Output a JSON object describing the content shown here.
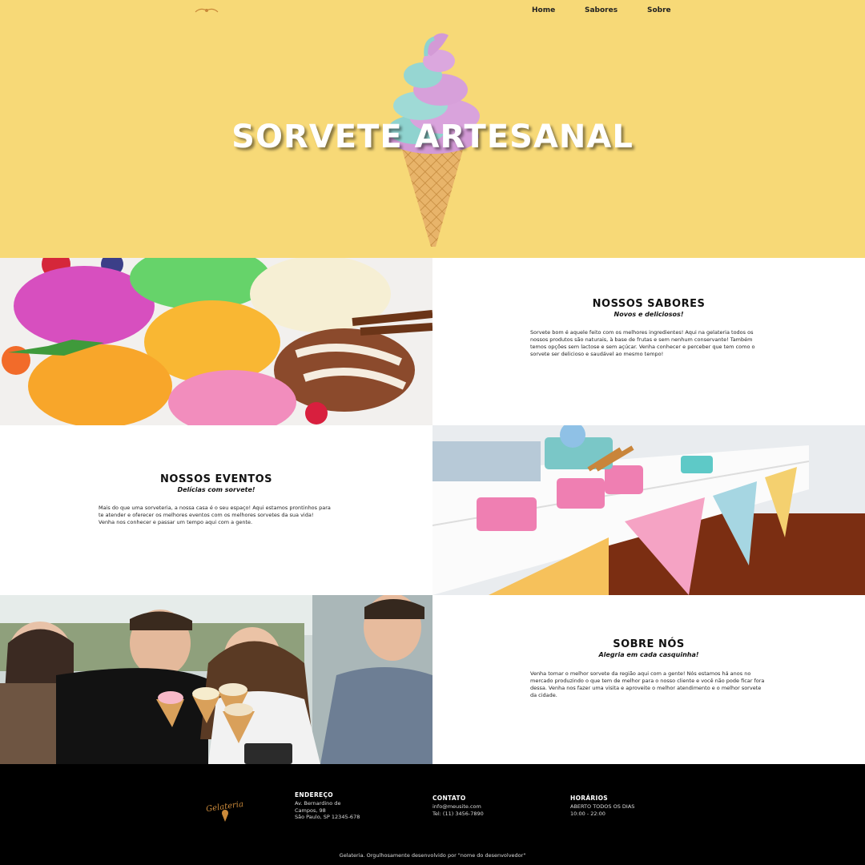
{
  "nav": {
    "items": [
      {
        "label": "Home"
      },
      {
        "label": "Sabores"
      },
      {
        "label": "Sobre"
      }
    ]
  },
  "hero": {
    "title": "SORVETE ARTESANAL"
  },
  "sections": [
    {
      "title": "NOSSOS SABORES",
      "subtitle": "Novos e deliciosos!",
      "body": "Sorvete bom é aquele feito com os melhores ingredientes! Aqui na gelateria todos os nossos produtos são naturais, à base de frutas e sem nenhum conservante! Também temos opções sem lactose e sem açúcar. Venha conhecer e perceber que tem como o sorvete ser delicioso e saudável ao mesmo tempo!"
    },
    {
      "title": "NOSSOS EVENTOS",
      "subtitle": "Delícias com sorvete!",
      "body": "Mais do que uma sorveteria, a nossa casa é o seu espaço! Aqui estamos prontinhos para te atender e oferecer os melhores eventos com os melhores sorvetes da sua vida! Venha nos conhecer e passar um tempo aqui com a gente."
    },
    {
      "title": "SOBRE NÓS",
      "subtitle": "Alegria em cada casquinha!",
      "body": "Venha tomar o melhor sorvete da região aqui com a gente! Nós estamos há anos no mercado produzindo o que tem de melhor para o nosso cliente e você não pode ficar fora dessa. Venha nos fazer uma visita e aproveite o melhor atendimento e o melhor sorvete da cidade."
    }
  ],
  "footer": {
    "logo_text": "Gelateria",
    "columns": [
      {
        "heading": "ENDEREÇO",
        "lines": [
          "Av. Bernardino de",
          "Campos, 98",
          "São Paulo, SP 12345-678"
        ]
      },
      {
        "heading": "CONTATO",
        "lines": [
          "info@meusite.com",
          "Tel: (11) 3456-7890"
        ]
      },
      {
        "heading": "HORÁRIOS",
        "lines": [
          "ABERTO TODOS OS DIAS",
          "10:00 - 22:00"
        ]
      }
    ],
    "copyright": "Gelateria. Orgulhosamente desenvolvido por \"nome do desenvolvedor\""
  },
  "colors": {
    "hero_bg": "#f7d977",
    "footer_bg": "#000000",
    "logo_accent": "#c9893a"
  }
}
